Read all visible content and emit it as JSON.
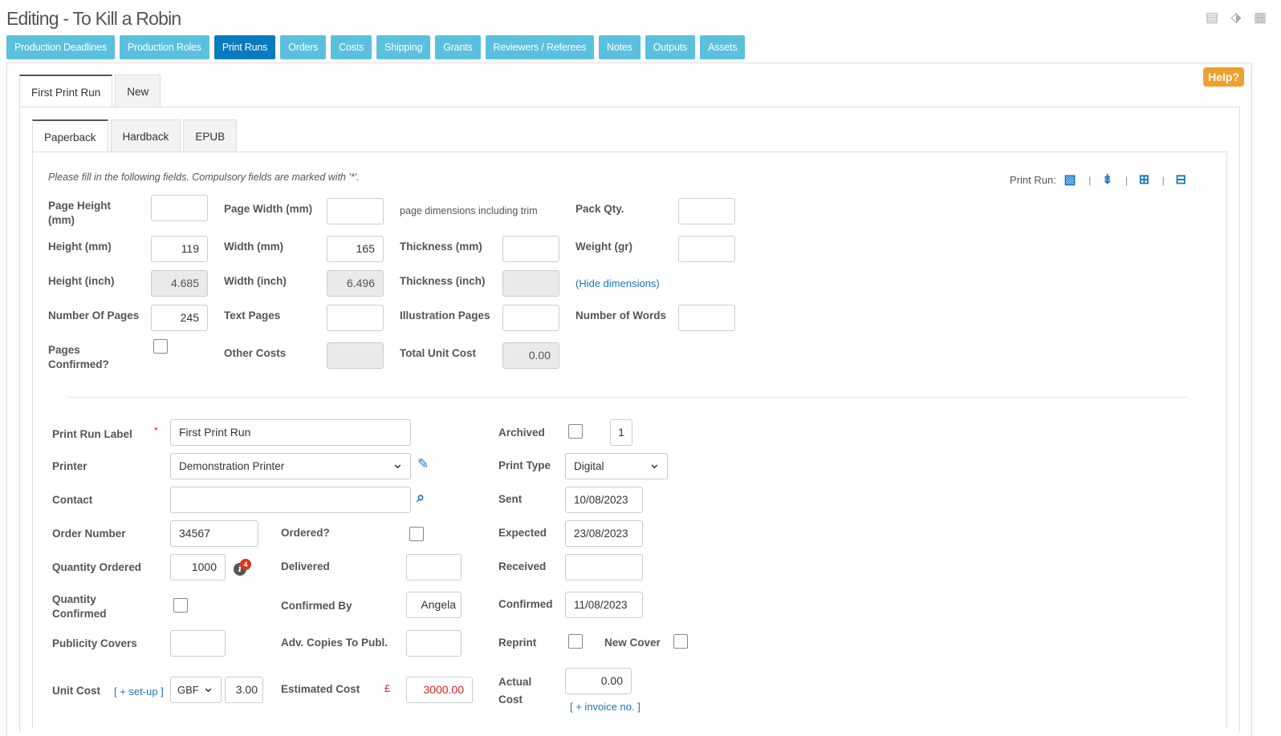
{
  "header": {
    "title": "Editing - To Kill a Robin",
    "help_label": "Help?"
  },
  "top_icons": [
    "book-icon",
    "tag-icon",
    "archive-icon"
  ],
  "nav": [
    {
      "label": "Production Deadlines"
    },
    {
      "label": "Production Roles"
    },
    {
      "label": "Print Runs",
      "active": true
    },
    {
      "label": "Orders"
    },
    {
      "label": "Costs"
    },
    {
      "label": "Shipping"
    },
    {
      "label": "Grants"
    },
    {
      "label": "Reviewers / Referees"
    },
    {
      "label": "Notes"
    },
    {
      "label": "Outputs"
    },
    {
      "label": "Assets"
    }
  ],
  "run_tabs": [
    {
      "label": "First Print Run"
    },
    {
      "label": "New"
    }
  ],
  "format_tabs": [
    {
      "label": "Paperback"
    },
    {
      "label": "Hardback"
    },
    {
      "label": "EPUB"
    }
  ],
  "note": "Please fill in the following fields. Compulsory fields are marked with '*'.",
  "print_run_label": "Print Run:",
  "dims": {
    "page_height_label": "Page Height (mm)",
    "page_width_label": "Page Width (mm)",
    "page_dim_note": "page dimensions including trim",
    "pack_qty_label": "Pack Qty.",
    "height_mm_label": "Height (mm)",
    "height_mm": "119",
    "width_mm_label": "Width (mm)",
    "width_mm": "165",
    "thickness_mm_label": "Thickness (mm)",
    "weight_label": "Weight (gr)",
    "height_inch_label": "Height (inch)",
    "height_inch": "4.685",
    "width_inch_label": "Width (inch)",
    "width_inch": "6.496",
    "thickness_inch_label": "Thickness (inch)",
    "hide_link": "(Hide dimensions)",
    "pages_label": "Number Of Pages",
    "pages": "245",
    "text_pages_label": "Text Pages",
    "illus_pages_label": "Illustration Pages",
    "words_label": "Number of Words",
    "pages_confirmed_label": "Pages Confirmed?",
    "other_costs_label": "Other Costs",
    "total_unit_cost_label": "Total Unit Cost",
    "total_unit_cost": "0.00"
  },
  "run": {
    "label_label": "Print Run Label",
    "required_mark": "*",
    "label_value": "First Print Run",
    "archived_label": "Archived",
    "archived_num": "1",
    "printer_label": "Printer",
    "printer_value": "Demonstration Printer",
    "print_type_label": "Print Type",
    "print_type_value": "Digital",
    "contact_label": "Contact",
    "sent_label": "Sent",
    "sent_value": "10/08/2023",
    "order_number_label": "Order Number",
    "order_number": "34567",
    "ordered_label": "Ordered?",
    "expected_label": "Expected",
    "expected_value": "23/08/2023",
    "qty_ordered_label": "Quantity Ordered",
    "qty_ordered": "1000",
    "qty_badge": "4",
    "delivered_label": "Delivered",
    "received_label": "Received",
    "qty_confirmed_label": "Quantity Confirmed",
    "confirmed_by_label": "Confirmed By",
    "confirmed_by": "Angela",
    "confirmed_label": "Confirmed",
    "confirmed_value": "11/08/2023",
    "publicity_label": "Publicity Covers",
    "adv_copies_label": "Adv. Copies To Publ.",
    "reprint_label": "Reprint",
    "new_cover_label": "New Cover",
    "unit_cost_label": "Unit Cost",
    "setup_link": "[ + set-up ]",
    "currency": "GBF",
    "unit_cost": "3.00",
    "est_cost_label": "Estimated Cost",
    "pound": "£",
    "est_cost": "3000.00",
    "actual_cost_label": "Actual Cost",
    "actual_cost": "0.00",
    "invoice_link": "[ + invoice no. ]"
  }
}
